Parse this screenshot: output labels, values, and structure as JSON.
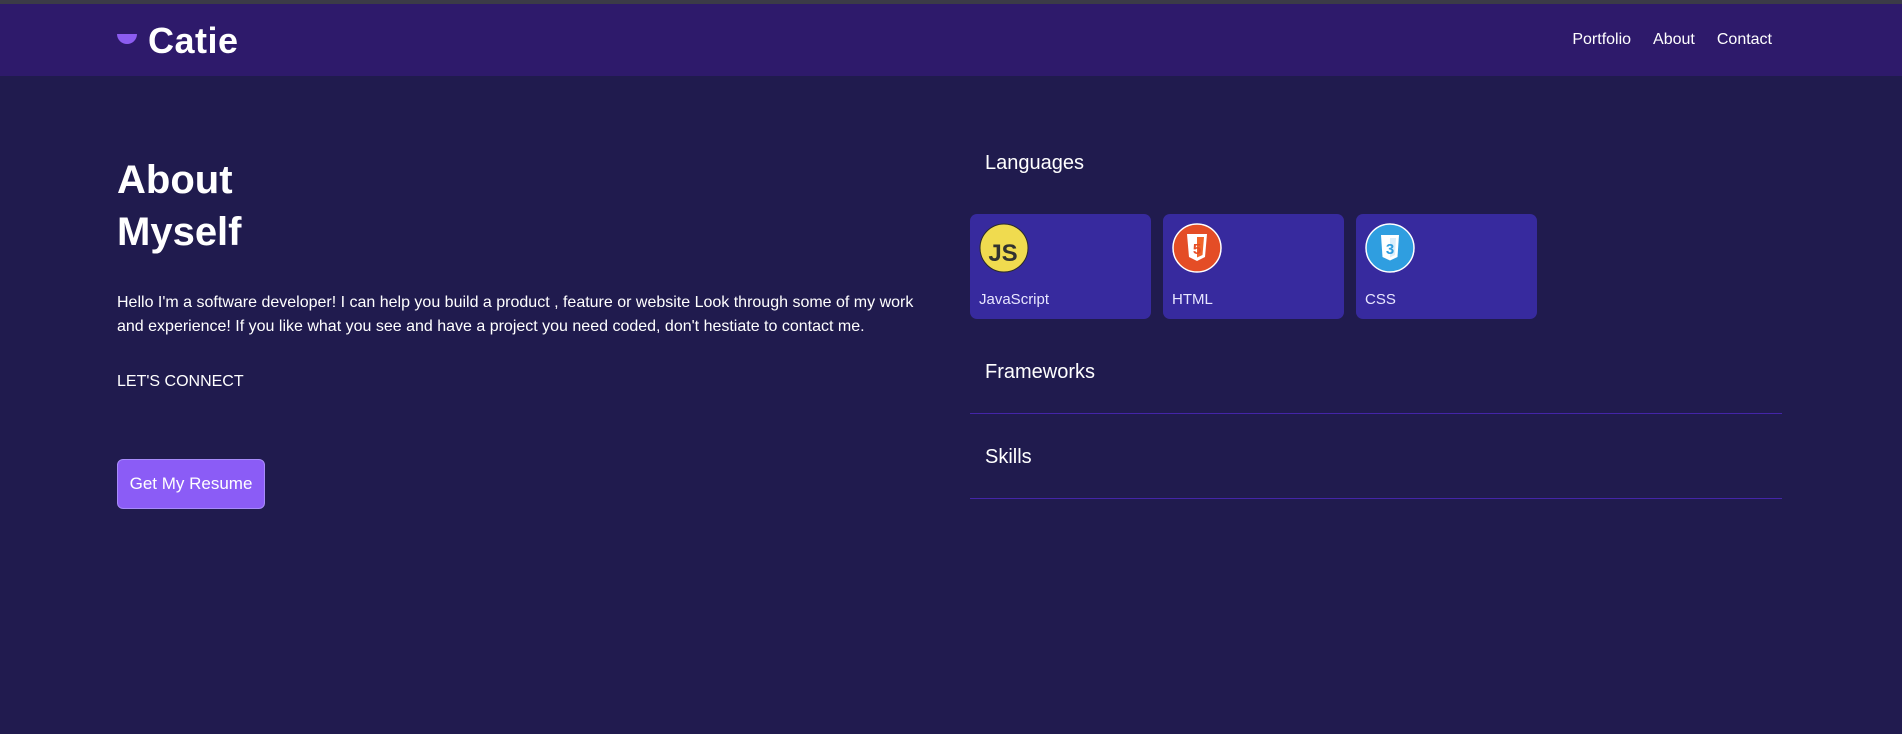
{
  "brand": {
    "name": "Catie",
    "accent": "#8c5cf0"
  },
  "nav": {
    "items": [
      {
        "label": "Portfolio"
      },
      {
        "label": "About"
      },
      {
        "label": "Contact"
      }
    ]
  },
  "hero": {
    "title_line1": "About",
    "title_line2": "Myself",
    "description": "Hello I'm a software developer! I can help you build a product , feature or website Look through some of my work and experience! If you like what you see and have a project you need coded, don't hestiate to contact me.",
    "connect_label": "LET'S CONNECT",
    "resume_button": "Get My Resume"
  },
  "skills": {
    "languages_title": "Languages",
    "languages": [
      {
        "label": "JavaScript",
        "icon": "javascript-icon"
      },
      {
        "label": "HTML",
        "icon": "html5-icon"
      },
      {
        "label": "CSS",
        "icon": "css3-icon"
      }
    ],
    "frameworks_title": "Frameworks",
    "skills_title": "Skills"
  },
  "colors": {
    "background": "#201b4e",
    "header": "#2e1a6b",
    "card": "#372a9e",
    "button": "#8b5cf6"
  }
}
